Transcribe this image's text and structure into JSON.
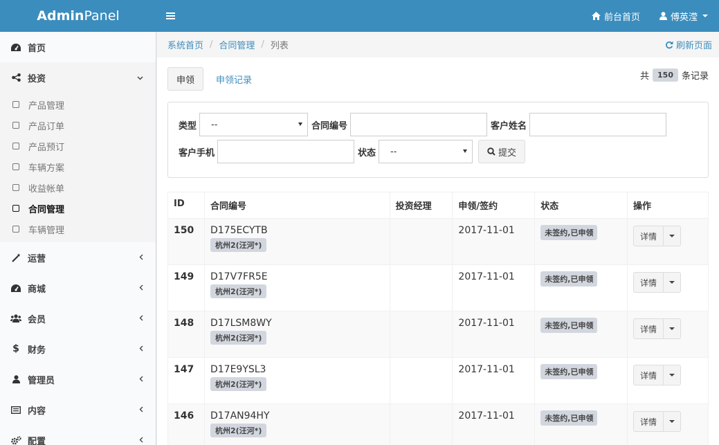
{
  "header": {
    "logo_bold": "Admin",
    "logo_rest": "Panel",
    "menu_icon": "bars-icon",
    "home_link": "前台首页",
    "user_name": "傅英滢"
  },
  "sidebar": {
    "items": [
      {
        "label": "首页",
        "icon": "dashboard-icon"
      },
      {
        "label": "投资",
        "icon": "share-icon",
        "expanded": true,
        "sub": [
          "产品管理",
          "产品订单",
          "产品预订",
          "车辆方案",
          "收益帐单",
          "合同管理",
          "车辆管理"
        ],
        "current": "合同管理"
      },
      {
        "label": "运营",
        "icon": "magic-icon"
      },
      {
        "label": "商城",
        "icon": "dashboard-icon"
      },
      {
        "label": "会员",
        "icon": "users-icon"
      },
      {
        "label": "财务",
        "icon": "dollar-icon"
      },
      {
        "label": "管理员",
        "icon": "user-icon"
      },
      {
        "label": "内容",
        "icon": "list-icon"
      },
      {
        "label": "配置",
        "icon": "cogs-icon"
      }
    ]
  },
  "breadcrumb": {
    "items": [
      "系统首页",
      "合同管理",
      "列表"
    ],
    "refresh": "刷新页面"
  },
  "tabs": {
    "active": "申领",
    "other": "申领记录"
  },
  "records": {
    "prefix": "共",
    "count": "150",
    "suffix": "条记录"
  },
  "filter": {
    "type_label": "类型",
    "type_value": "--",
    "contract_label": "合同编号",
    "contract_value": "",
    "name_label": "客户姓名",
    "name_value": "",
    "phone_label": "客户手机",
    "phone_value": "",
    "status_label": "状态",
    "status_value": "--",
    "submit": "提交"
  },
  "table": {
    "headers": [
      "ID",
      "合同编号",
      "投资经理",
      "申领/签约",
      "状态",
      "操作"
    ],
    "rows": [
      {
        "id": "150",
        "contract": "D175ECYTB",
        "location": "杭州2(汪河*)",
        "manager": "",
        "date": "2017-11-01",
        "status": "未签约,已申领",
        "action": "详情"
      },
      {
        "id": "149",
        "contract": "D17V7FR5E",
        "location": "杭州2(汪河*)",
        "manager": "",
        "date": "2017-11-01",
        "status": "未签约,已申领",
        "action": "详情"
      },
      {
        "id": "148",
        "contract": "D17LSM8WY",
        "location": "杭州2(汪河*)",
        "manager": "",
        "date": "2017-11-01",
        "status": "未签约,已申领",
        "action": "详情"
      },
      {
        "id": "147",
        "contract": "D17E9YSL3",
        "location": "杭州2(汪河*)",
        "manager": "",
        "date": "2017-11-01",
        "status": "未签约,已申领",
        "action": "详情"
      },
      {
        "id": "146",
        "contract": "D17AN94HY",
        "location": "杭州2(汪河*)",
        "manager": "",
        "date": "2017-11-01",
        "status": "未签约,已申领",
        "action": "详情"
      }
    ]
  },
  "colors": {
    "header_bg": "#3b8dbd",
    "link": "#3c8dbc",
    "badge_bg": "#d2d6de"
  }
}
